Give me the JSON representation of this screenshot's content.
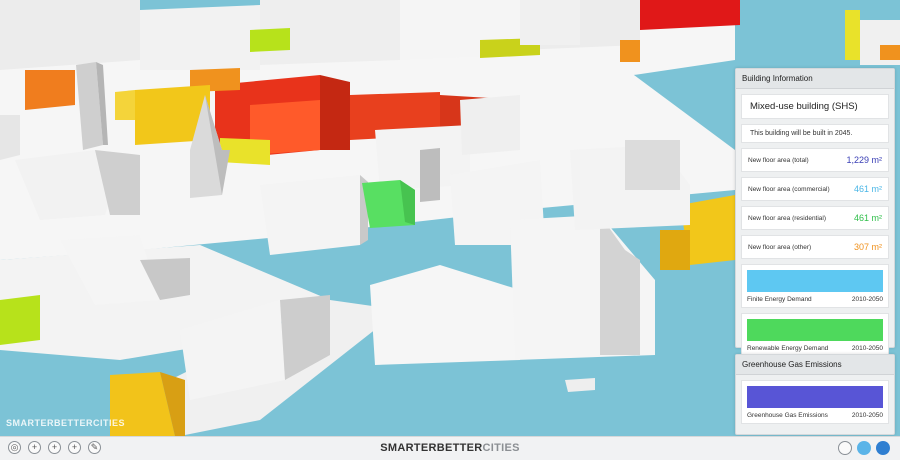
{
  "app": {
    "brand_dark": "SMARTERBETTER",
    "brand_light": "CITIES",
    "watermark": "SMARTERBETTERCITIES"
  },
  "building_panel": {
    "header": "Building Information",
    "building_name": "Mixed-use building (SHS)",
    "note": "This building will be built in 2045.",
    "rows": [
      {
        "label": "New floor area (total)",
        "value": "1,229 m²",
        "color": "#3a3fb5"
      },
      {
        "label": "New floor area (commercial)",
        "value": "461 m²",
        "color": "#4ab6e6"
      },
      {
        "label": "New floor area (residential)",
        "value": "461 m²",
        "color": "#2fbf4a"
      },
      {
        "label": "New floor area (other)",
        "value": "307 m²",
        "color": "#f0921e"
      }
    ],
    "energy": [
      {
        "label": "Finite Energy Demand",
        "range": "2010-2050",
        "color": "#5ec8f2"
      },
      {
        "label": "Renewable Energy Demand",
        "range": "2010-2050",
        "color": "#4ed95c"
      }
    ]
  },
  "ghg_panel": {
    "header": "Greenhouse Gas Emissions",
    "bar": {
      "label": "Greenhouse Gas Emissions",
      "range": "2010-2050",
      "color": "#5855d6"
    }
  },
  "toolbar": {
    "left_tools": [
      "globe-icon",
      "zoom-in-icon",
      "add-icon",
      "add-alt-icon",
      "edit-icon"
    ],
    "right_tools": [
      "layers-icon",
      "chart-icon",
      "close-icon"
    ]
  },
  "scene_colors": {
    "water": "#7cc3d6",
    "building_white": "#f4f4f4",
    "building_red": "#e8331b",
    "building_orange": "#f07d1e",
    "building_yellow": "#f2c71a",
    "building_lime": "#b7e21b",
    "selected_green": "#58df62"
  }
}
